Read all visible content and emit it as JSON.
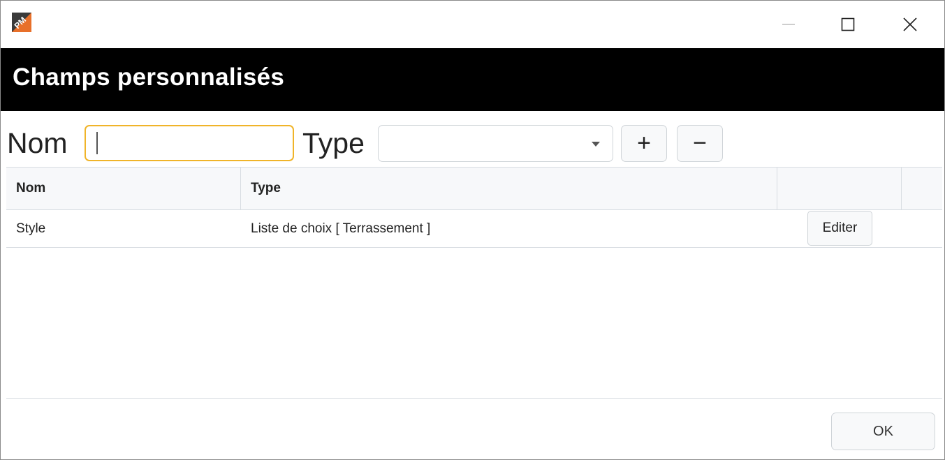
{
  "window": {
    "app_icon": "pm-app-icon",
    "controls": {
      "minimize": "—",
      "maximize": "☐",
      "close": "✕"
    }
  },
  "header": {
    "title": "Champs personnalisés"
  },
  "toolbar": {
    "name_label": "Nom",
    "name_value": "",
    "type_label": "Type",
    "type_value": "",
    "add_label": "+",
    "remove_label": "−"
  },
  "table": {
    "columns": [
      "Nom",
      "Type",
      "",
      ""
    ],
    "rows": [
      {
        "nom": "Style",
        "type": "Liste de choix [ Terrassement ]",
        "action": "Editer"
      }
    ]
  },
  "footer": {
    "ok_label": "OK"
  },
  "colors": {
    "banner": "#000000",
    "focus_border": "#f0b429",
    "app_icon_accent": "#e8702a"
  }
}
